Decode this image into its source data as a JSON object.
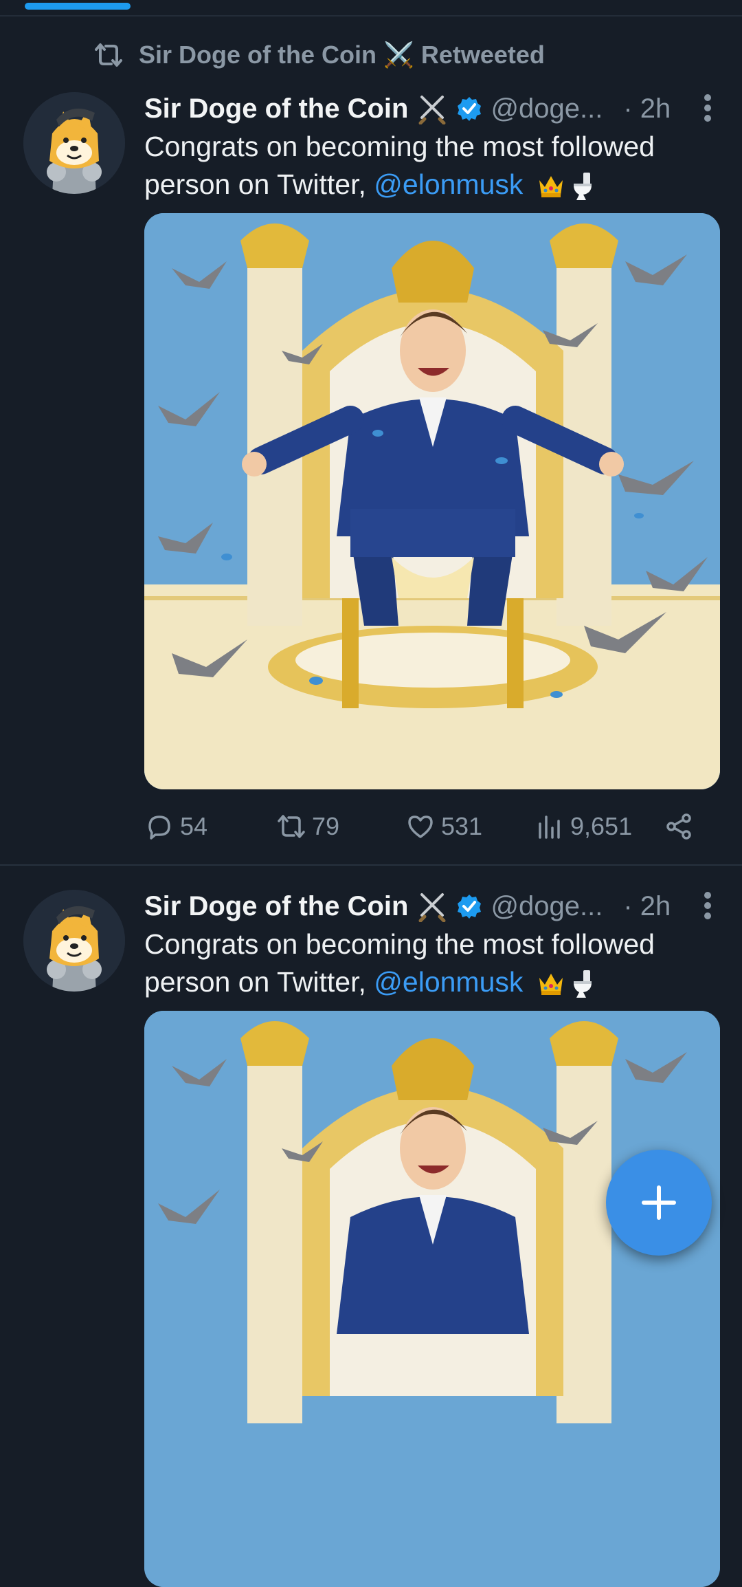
{
  "retweet": {
    "label": "Sir Doge of the Coin ⚔️ Retweeted",
    "name": "Sir Doge of the Coin",
    "suffix": "Retweeted"
  },
  "tweets": [
    {
      "author": "Sir Doge of the Coin",
      "handle": "@doge...",
      "time": "· 2h",
      "text_before": "Congrats on becoming the most followed person on Twitter, ",
      "mention": "@elonmusk",
      "emoji": [
        "crown",
        "toilet"
      ],
      "stats": {
        "replies": "54",
        "retweets": "79",
        "likes": "531",
        "views": "9,651"
      }
    },
    {
      "author": "Sir Doge of the Coin",
      "handle": "@doge...",
      "time": "· 2h",
      "text_before": "Congrats on becoming the most followed person on Twitter, ",
      "mention": "@elonmusk",
      "emoji": [
        "crown",
        "toilet"
      ]
    }
  ],
  "icons": [
    "retweet-icon",
    "crossed-swords-icon",
    "verified-badge-icon",
    "more-icon",
    "reply-icon",
    "like-icon",
    "views-icon",
    "share-icon",
    "compose-plus-icon"
  ],
  "colors": {
    "background": "#161d27",
    "accent": "#1d9bf0",
    "muted": "#8b98a5",
    "mention": "#3b9cf5",
    "fab": "#3a8fe6"
  }
}
